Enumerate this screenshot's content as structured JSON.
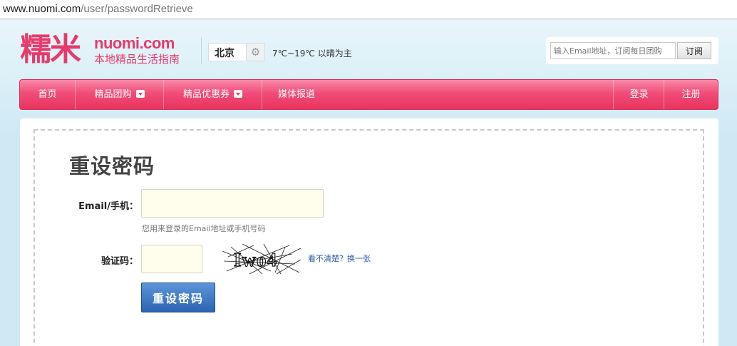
{
  "browser": {
    "url_host": "www.nuomi.com",
    "url_path": "/user/passwordRetrieve"
  },
  "header": {
    "logo_cn": "糯米",
    "logo_en": "nuomi.com",
    "logo_tagline": "本地精品生活指南",
    "city": "北京",
    "city_icon": "gear-icon",
    "weather": "7℃~19℃ 以晴为主",
    "subscribe": {
      "placeholder": "输入Email地址，订阅每日团购",
      "button_label": "订阅"
    }
  },
  "nav": {
    "items": [
      {
        "label": "首页"
      },
      {
        "label": "精品团购",
        "dropdown": true
      },
      {
        "label": "精品优惠券",
        "dropdown": true
      },
      {
        "label": "媒体报道"
      }
    ],
    "right_items": [
      {
        "label": "登录"
      },
      {
        "label": "注册"
      }
    ]
  },
  "form": {
    "title": "重设密码",
    "email_label": "Email/手机：",
    "email_value": "",
    "email_hint": "您用来登录的Email地址或手机号码",
    "captcha_label": "验证码：",
    "captcha_value": "",
    "captcha_text": "Iwo4",
    "refresh_link": "看不清楚？换一张",
    "submit_label": "重设密码"
  },
  "colors": {
    "brand_pink": "#e83a6a",
    "nav_gradient_top": "#f98aa7",
    "nav_gradient_bottom": "#e8335f",
    "button_blue": "#2c64b4",
    "input_bg": "#fffdeb"
  }
}
